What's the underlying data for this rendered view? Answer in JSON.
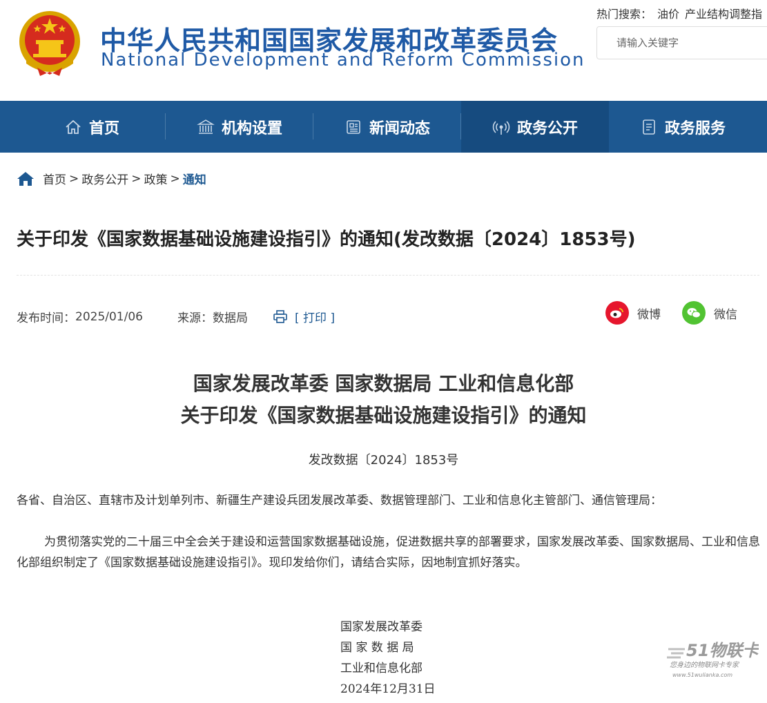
{
  "header": {
    "title_cn": "中华人民共和国国家发展和改革委员会",
    "title_en": "National Development and Reform Commission",
    "hot_label": "热门搜索：",
    "hot_terms": [
      "油价",
      "产业结构调整指"
    ],
    "search_placeholder": "请输入关键字"
  },
  "nav": {
    "items": [
      {
        "label": "首页",
        "icon": "home-icon"
      },
      {
        "label": "机构设置",
        "icon": "building-icon"
      },
      {
        "label": "新闻动态",
        "icon": "newspaper-icon"
      },
      {
        "label": "政务公开",
        "icon": "broadcast-icon",
        "active": true
      },
      {
        "label": "政务服务",
        "icon": "document-icon"
      }
    ]
  },
  "breadcrumb": {
    "items": [
      "首页",
      "政务公开",
      "政策",
      "通知"
    ],
    "separator": ">"
  },
  "article": {
    "title": "关于印发《国家数据基础设施建设指引》的通知(发改数据〔2024〕1853号)",
    "publish_label": "发布时间：",
    "publish_date": "2025/01/06",
    "source_label": "来源：",
    "source": "数据局",
    "print_label": "[ 打印 ]",
    "share": {
      "weibo": "微博",
      "wechat": "微信"
    }
  },
  "document": {
    "heading_line1": "国家发展改革委 国家数据局 工业和信息化部",
    "heading_line2": "关于印发《国家数据基础设施建设指引》的通知",
    "number": "发改数据〔2024〕1853号",
    "recipients": "各省、自治区、直辖市及计划单列市、新疆生产建设兵团发展改革委、数据管理部门、工业和信息化主管部门、通信管理局：",
    "paragraph": "为贯彻落实党的二十届三中全会关于建设和运营国家数据基础设施，促进数据共享的部署要求，国家发展改革委、国家数据局、工业和信息化部组织制定了《国家数据基础设施建设指引》。现印发给你们，请结合实际，因地制宜抓好落实。",
    "signatures": [
      "国家发展改革委",
      "国 家 数 据 局",
      "工业和信息化部"
    ],
    "date": "2024年12月31日"
  },
  "watermark": {
    "brand": "51物联卡",
    "tagline": "您身边的物联网卡专家",
    "url": "www.51wulianka.com"
  },
  "colors": {
    "nav_bg": "#1d5891",
    "nav_active": "#164b7f",
    "title_blue": "#1f5aa6",
    "weibo_red": "#e6162d",
    "wechat_green": "#51c332"
  }
}
